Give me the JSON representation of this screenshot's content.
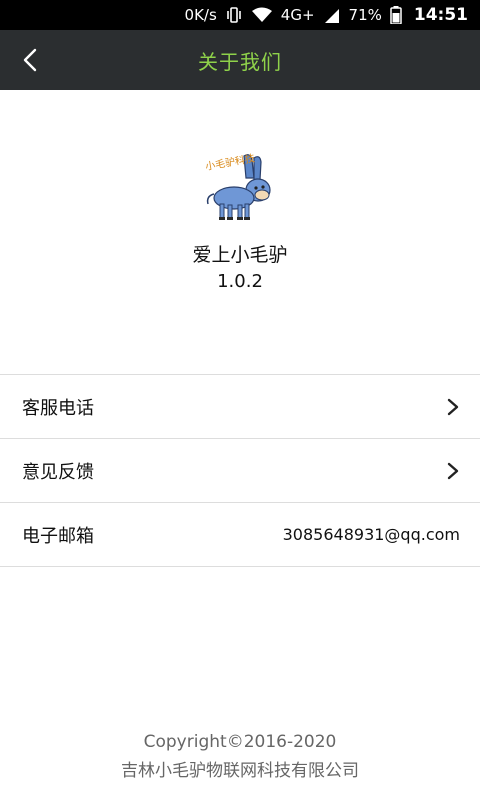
{
  "status_bar": {
    "network_speed": "0K/s",
    "network_type": "4G+",
    "battery": "71%",
    "time": "14:51",
    "icons": [
      "vibrate-icon",
      "wifi-icon",
      "signal-icon",
      "battery-icon"
    ]
  },
  "header": {
    "back_icon": "back-arrow-icon",
    "title": "关于我们",
    "title_color": "#8fd24a",
    "background": "#2b2e30"
  },
  "app": {
    "logo": "donkey-logo",
    "logo_text": "小毛驴科技",
    "name": "爱上小毛驴",
    "version": "1.0.2"
  },
  "list": {
    "items": [
      {
        "label": "客服电话",
        "action_icon": "chevron-right-icon"
      },
      {
        "label": "意见反馈",
        "action_icon": "chevron-right-icon"
      },
      {
        "label": "电子邮箱",
        "value": "3085648931@qq.com"
      }
    ]
  },
  "footer": {
    "copyright": "Copyright©2016-2020",
    "company": "吉林小毛驴物联网科技有限公司"
  }
}
